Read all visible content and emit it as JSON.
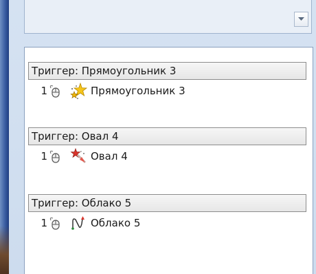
{
  "animation_list": {
    "groups": [
      {
        "header": "Триггер: Прямоугольник 3",
        "order": "1",
        "effect_icon": "star-burst-icon",
        "effect_label": "Прямоугольник 3"
      },
      {
        "header": "Триггер: Овал 4",
        "order": "1",
        "effect_icon": "exit-star-icon",
        "effect_label": "Овал 4"
      },
      {
        "header": "Триггер: Облако 5",
        "order": "1",
        "effect_icon": "motion-path-icon",
        "effect_label": "Облако 5"
      }
    ]
  },
  "icons": {
    "start": "mouse-click-icon",
    "dropdown": "dropdown-arrow-icon"
  },
  "colors": {
    "accent_blue": "#3c5fa3",
    "star_yellow": "#f6c51b",
    "star_red": "#d9342b",
    "path_green": "#2e8b3e"
  }
}
